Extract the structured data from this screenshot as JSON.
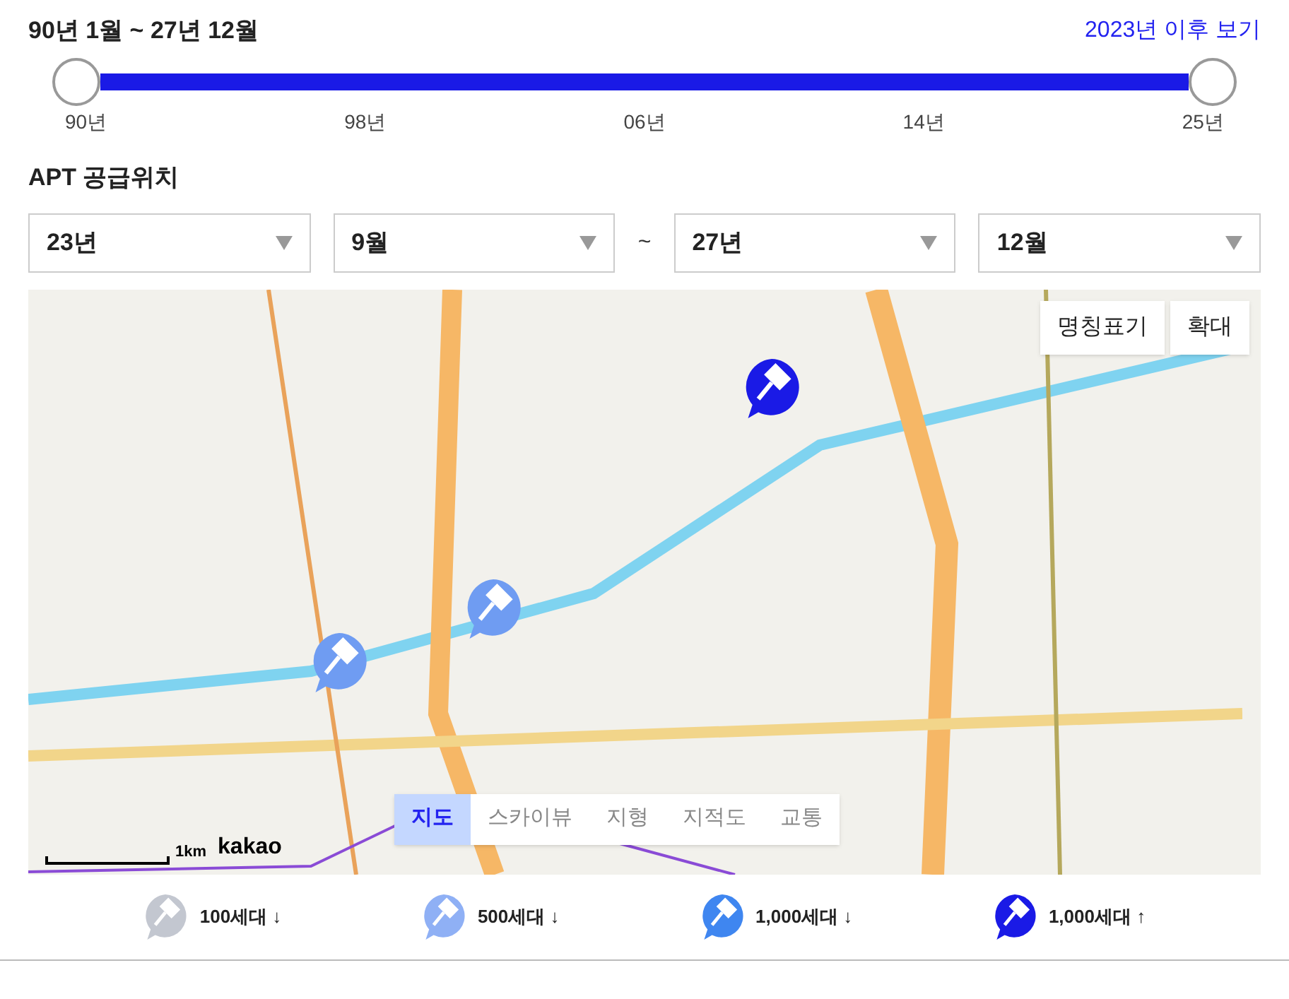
{
  "period": {
    "title": "90년 1월 ~ 27년 12월",
    "link": "2023년 이후 보기"
  },
  "slider": {
    "handles": [
      {
        "level": 0
      },
      {
        "level": 1
      }
    ],
    "ticks": [
      "90년",
      "98년",
      "06년",
      "14년",
      "25년"
    ]
  },
  "section_title": "APT 공급위치",
  "selects": [
    {
      "value": "23년"
    },
    {
      "value": "9월"
    },
    {
      "value": "27년",
      "separator": "~"
    },
    {
      "value": "12월"
    }
  ],
  "map": {
    "buttons": [
      "명칭표기",
      "확대"
    ],
    "markers": [
      {
        "color": "#1a1ae6"
      },
      {
        "color": "#6f9cf2"
      },
      {
        "color": "#6f9cf2"
      }
    ],
    "map_types": [
      {
        "label": "지도",
        "selected": true
      },
      {
        "label": "스카이뷰",
        "selected": false
      },
      {
        "label": "지형",
        "selected": false
      },
      {
        "label": "지적도",
        "selected": false
      },
      {
        "label": "교통",
        "selected": false
      }
    ],
    "scale": "1km",
    "brand": "kakao"
  },
  "legend": [
    {
      "label": "100세대",
      "arrow": "↓",
      "color": "#c3c7d0"
    },
    {
      "label": "500세대",
      "arrow": "↓",
      "color": "#8fb0f5"
    },
    {
      "label": "1,000세대",
      "arrow": "↓",
      "color": "#3f86f0"
    },
    {
      "label": "1,000세대",
      "arrow": "↑",
      "color": "#1a1ae6"
    }
  ]
}
